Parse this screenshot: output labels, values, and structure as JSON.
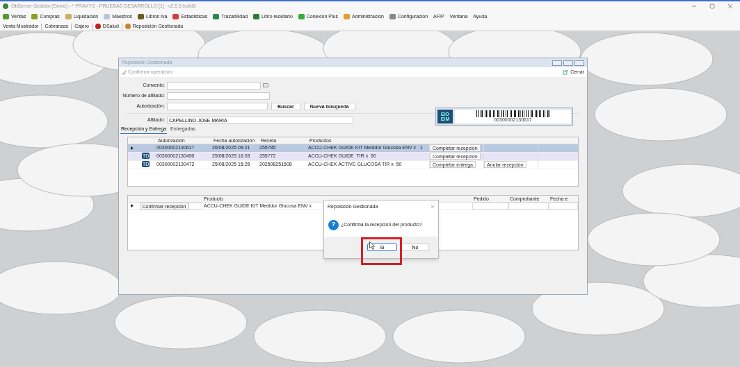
{
  "window": {
    "title": "ObServer Gestión (Demo) - * PRAXYS - PRUEBAS DESARROLLO [1] - v2.5.5 build0"
  },
  "menu": [
    {
      "label": "Ventas",
      "icon": true
    },
    {
      "label": "Compras",
      "icon": true
    },
    {
      "label": "Liquidación",
      "icon": true
    },
    {
      "label": "Maestros",
      "icon": true
    },
    {
      "label": "Libros Iva",
      "icon": true
    },
    {
      "label": "Estadísticas",
      "icon": true
    },
    {
      "label": "Trazabilidad",
      "icon": true
    },
    {
      "label": "Libro recetario",
      "icon": true
    },
    {
      "label": "Conexión Plus",
      "icon": true
    },
    {
      "label": "Administración",
      "icon": true
    },
    {
      "label": "Configuración",
      "icon": true
    },
    {
      "label": "AFIP",
      "icon": false
    },
    {
      "label": "Ventana",
      "icon": false
    },
    {
      "label": "Ayuda",
      "icon": false
    }
  ],
  "toolbar": [
    {
      "label": "Venta Mostrador",
      "icon": false
    },
    {
      "label": "Cobranzas",
      "icon": false
    },
    {
      "label": "Cajero",
      "icon": false
    },
    {
      "label": "DSalud",
      "icon": true
    },
    {
      "label": "Reposición Gestionada",
      "icon": true
    }
  ],
  "child_window": {
    "title": "Reposición Gestionada",
    "action": "Confirmar operación",
    "close": "Cerrar",
    "fields": [
      {
        "label": "Convenio:"
      },
      {
        "label": "Número de afiliado:"
      },
      {
        "label": "Autorización:"
      }
    ],
    "buttons": [
      "Buscar",
      "Nueva búsqueda"
    ],
    "affiliate": {
      "label": "Afiliado:",
      "value": "CAPELLINO JOSE MARIA"
    },
    "tabs": [
      {
        "label": "Recepción y Entrega",
        "selected": true
      },
      {
        "label": "Entregadas",
        "selected": false
      }
    ],
    "logo_text": "EIO EIM",
    "barcode": "00300002130617",
    "grid": {
      "columns": [
        "Autorización",
        "Fecha autorización",
        "Receta",
        "Productos"
      ],
      "rows": [
        {
          "selected": true,
          "hovered": false,
          "cells": [
            "00300002130617",
            "26/08/2025 09:21",
            "255785",
            "ACCU-CHEK GUIDE KIT Medidor Glucosa ENV x   1"
          ],
          "actions": [
            "Completar recepción"
          ]
        },
        {
          "selected": false,
          "hovered": true,
          "badge": "TD",
          "cells": [
            "00300002130490",
            "25/08/2025 16:03",
            "255772",
            "ACCU-CHEK GUIDE  TIR x  50"
          ],
          "actions": [
            "Completar recepción"
          ]
        },
        {
          "selected": false,
          "hovered": false,
          "badge": "TD",
          "cells": [
            "00300002130472",
            "25/08/2025 15:25",
            "202508251508",
            "ACCU-CHEK ACTIVE GLUCOSA TIR x  50"
          ],
          "actions": [
            "Completar entrega",
            "Anular recepción"
          ]
        }
      ]
    },
    "detail": {
      "columns": [
        "Producto",
        "Pedido",
        "Comprobante",
        "Fecha e"
      ],
      "rows": [
        {
          "button": "Confirmar recepción",
          "product": "ACCU-CHEK GUIDE KIT Medidor Glucosa ENV x"
        }
      ]
    }
  },
  "dialog": {
    "title": "Reposición Gestionada",
    "icon_glyph": "?",
    "message": "¿Confirma la recepción del producto?",
    "buttons": [
      {
        "label": "Sí",
        "selected": true
      },
      {
        "label": "No",
        "selected": false
      }
    ]
  }
}
